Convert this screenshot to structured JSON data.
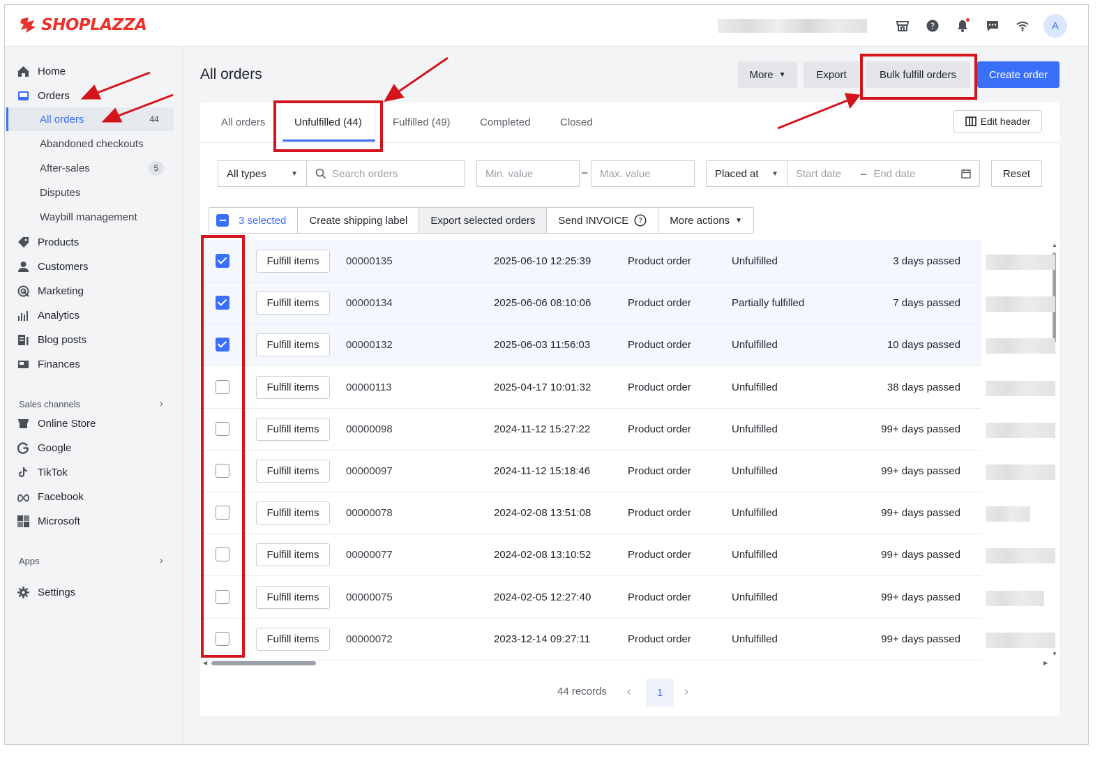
{
  "brand": {
    "name": "SHOPLAZZA",
    "color": "#e8322c"
  },
  "header": {
    "icons": [
      "store-icon",
      "help-icon",
      "bell-icon",
      "message-icon",
      "wifi-icon"
    ],
    "avatar_initial": "A"
  },
  "sidebar": {
    "home": "Home",
    "orders": "Orders",
    "all_orders": "All orders",
    "all_orders_count": "44",
    "abandoned": "Abandoned checkouts",
    "after_sales": "After-sales",
    "after_sales_count": "5",
    "disputes": "Disputes",
    "waybill": "Waybill management",
    "products": "Products",
    "customers": "Customers",
    "marketing": "Marketing",
    "analytics": "Analytics",
    "blog": "Blog posts",
    "finances": "Finances",
    "sales_channels": "Sales channels",
    "online_store": "Online Store",
    "google": "Google",
    "tiktok": "TikTok",
    "facebook": "Facebook",
    "microsoft": "Microsoft",
    "apps": "Apps",
    "settings": "Settings"
  },
  "page": {
    "title": "All orders",
    "more": "More",
    "export": "Export",
    "bulk_fulfill": "Bulk fulfill orders",
    "create_order": "Create order"
  },
  "tabs": {
    "all": "All orders",
    "unfulfilled": "Unfulfilled (44)",
    "fulfilled": "Fulfilled (49)",
    "completed": "Completed",
    "closed": "Closed",
    "edit_header": "Edit header"
  },
  "filters": {
    "type": "All types",
    "search_placeholder": "Search orders",
    "min_placeholder": "Min. value",
    "dash": "–",
    "max_placeholder": "Max. value",
    "placed_at": "Placed at",
    "start_placeholder": "Start date",
    "end_placeholder": "End date",
    "reset": "Reset"
  },
  "bulk": {
    "selected": "3 selected",
    "shipping_label": "Create shipping label",
    "export_selected": "Export selected orders",
    "send_invoice": "Send INVOICE",
    "more_actions": "More actions"
  },
  "fulfill_label": "Fulfill items",
  "orders": [
    {
      "id": "00000135",
      "date": "2025-06-10 12:25:39",
      "type": "Product order",
      "status": "Unfulfilled",
      "days": "3 days passed",
      "checked": true
    },
    {
      "id": "00000134",
      "date": "2025-06-06 08:10:06",
      "type": "Product order",
      "status": "Partially fulfilled",
      "days": "7 days passed",
      "checked": true
    },
    {
      "id": "00000132",
      "date": "2025-06-03 11:56:03",
      "type": "Product order",
      "status": "Unfulfilled",
      "days": "10 days passed",
      "checked": true
    },
    {
      "id": "00000113",
      "date": "2025-04-17 10:01:32",
      "type": "Product order",
      "status": "Unfulfilled",
      "days": "38 days passed",
      "checked": false
    },
    {
      "id": "00000098",
      "date": "2024-11-12 15:27:22",
      "type": "Product order",
      "status": "Unfulfilled",
      "days": "99+ days passed",
      "checked": false
    },
    {
      "id": "00000097",
      "date": "2024-11-12 15:18:46",
      "type": "Product order",
      "status": "Unfulfilled",
      "days": "99+ days passed",
      "checked": false
    },
    {
      "id": "00000078",
      "date": "2024-02-08 13:51:08",
      "type": "Product order",
      "status": "Unfulfilled",
      "days": "99+ days passed",
      "checked": false
    },
    {
      "id": "00000077",
      "date": "2024-02-08 13:10:52",
      "type": "Product order",
      "status": "Unfulfilled",
      "days": "99+ days passed",
      "checked": false
    },
    {
      "id": "00000075",
      "date": "2024-02-05 12:27:40",
      "type": "Product order",
      "status": "Unfulfilled",
      "days": "99+ days passed",
      "checked": false
    },
    {
      "id": "00000072",
      "date": "2023-12-14 09:27:11",
      "type": "Product order",
      "status": "Unfulfilled",
      "days": "99+ days passed",
      "checked": false
    }
  ],
  "pagination": {
    "records": "44 records",
    "current": "1"
  },
  "colors": {
    "accent": "#3a6ff7",
    "annotation": "#d4141c"
  }
}
